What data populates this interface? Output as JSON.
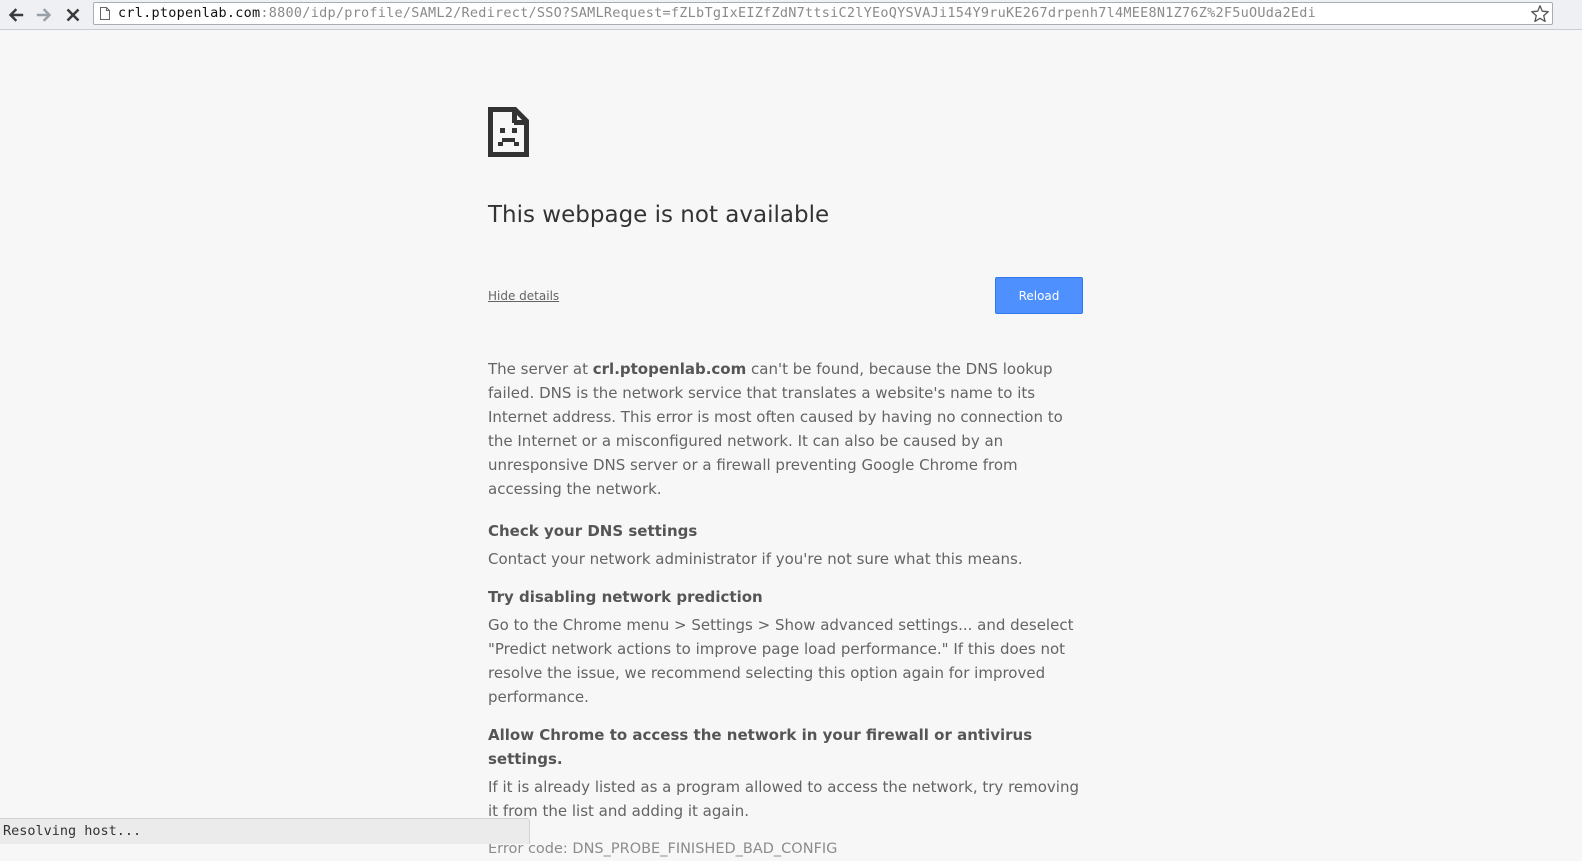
{
  "toolbar": {
    "back_icon": "arrow-left-icon",
    "forward_icon": "arrow-right-icon",
    "stop_icon": "close-icon",
    "page_icon": "document-icon",
    "bookmark_icon": "star-icon"
  },
  "omnibox": {
    "url_host": "crl.ptopenlab.com",
    "url_rest": ":8800/idp/profile/SAML2/Redirect/SSO?SAMLRequest=fZLbTgIxEIZfZdN7ttsiC2lYEoQYSVAJi154Y9ruKE267drpenh7l4MEE8N1Z76Z%2F5uOUda2Edi"
  },
  "error_page": {
    "icon": "sad-page-icon",
    "title": "This webpage is not available",
    "hide_details_label": "Hide details",
    "reload_label": "Reload",
    "summary_prefix": "The server at ",
    "summary_host": "crl.ptopenlab.com",
    "summary_suffix": " can't be found, because the DNS lookup failed. DNS is the network service that translates a website's name to its Internet address. This error is most often caused by having no connection to the Internet or a misconfigured network. It can also be caused by an unresponsive DNS server or a firewall preventing Google Chrome from accessing the network.",
    "suggestions": [
      {
        "heading": "Check your DNS settings",
        "body": "Contact your network administrator if you're not sure what this means."
      },
      {
        "heading": "Try disabling network prediction",
        "body": "Go to the Chrome menu > Settings > Show advanced settings... and deselect \"Predict network actions to improve page load performance.\" If this does not resolve the issue, we recommend selecting this option again for improved performance."
      },
      {
        "heading": "Allow Chrome to access the network in your firewall or antivirus settings.",
        "body": "If it is already listed as a program allowed to access the network, try removing it from the list and adding it again."
      }
    ],
    "error_code": "Error code: DNS_PROBE_FINISHED_BAD_CONFIG"
  },
  "status_bar": {
    "text": "Resolving host..."
  },
  "colors": {
    "reload_button": "#4d90fe",
    "title_text": "#333333",
    "body_text": "#646464",
    "page_background": "#f7f7f7"
  }
}
